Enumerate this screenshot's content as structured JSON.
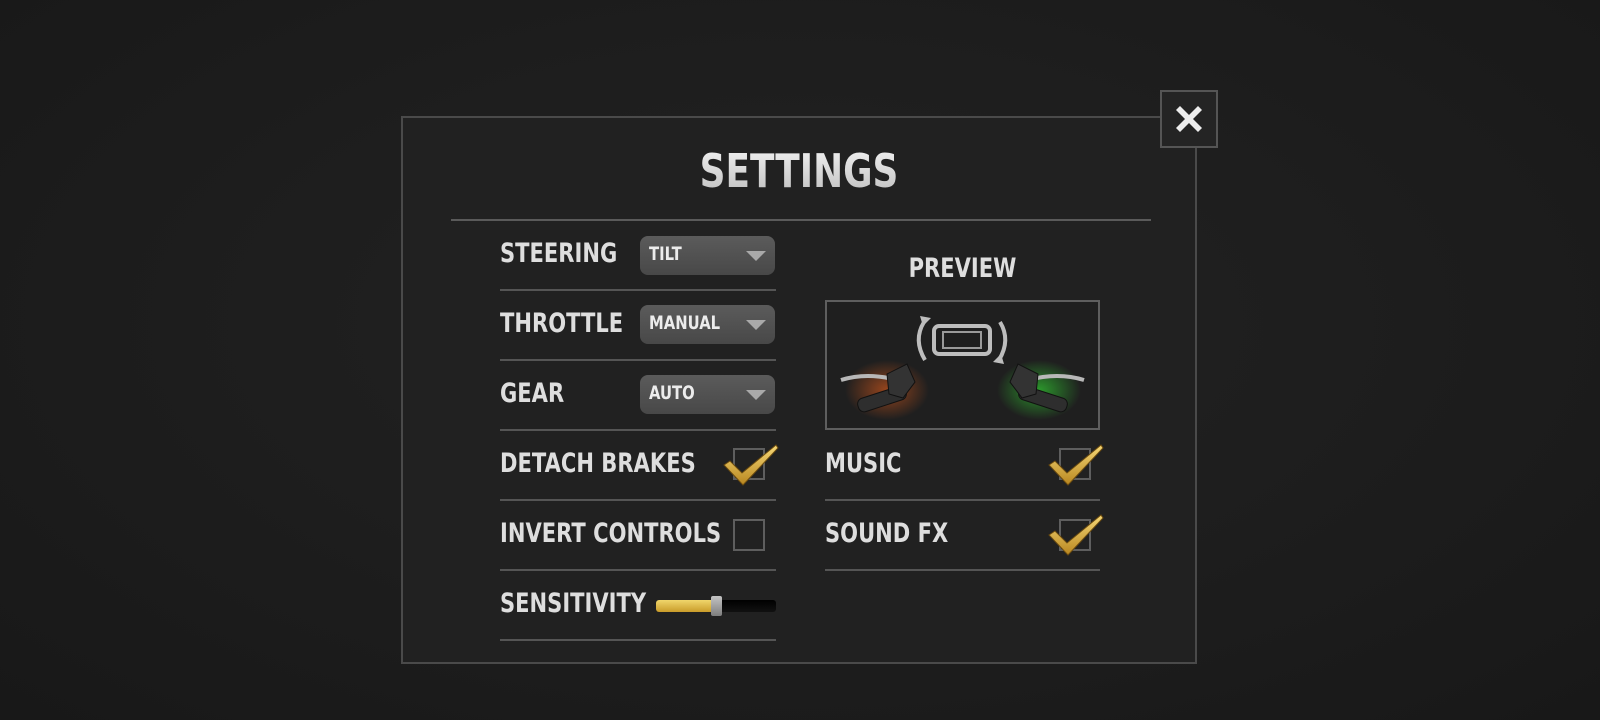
{
  "settings": {
    "title": "SETTINGS",
    "close_icon": "close-x-icon",
    "left": {
      "steering": {
        "label": "STEERING",
        "value": "TILT"
      },
      "throttle": {
        "label": "THROTTLE",
        "value": "MANUAL"
      },
      "gear": {
        "label": "GEAR",
        "value": "AUTO"
      },
      "detach_brakes": {
        "label": "DETACH BRAKES",
        "checked": true
      },
      "invert_controls": {
        "label": "INVERT CONTROLS",
        "checked": false
      },
      "sensitivity": {
        "label": "SENSITIVITY",
        "level": 0.5
      }
    },
    "right": {
      "preview": {
        "label": "PREVIEW",
        "icons": [
          "tilt-phone-icon",
          "brake-lever-icon",
          "throttle-lever-icon"
        ]
      },
      "music": {
        "label": "MUSIC",
        "checked": true
      },
      "sound_fx": {
        "label": "SOUND FX",
        "checked": true
      }
    }
  },
  "colors": {
    "background": "#1c1c1c",
    "panel": "#212121",
    "accent_gold": "#e0b23a",
    "brake_glow": "#c0521c",
    "throttle_glow": "#2fb52f"
  }
}
